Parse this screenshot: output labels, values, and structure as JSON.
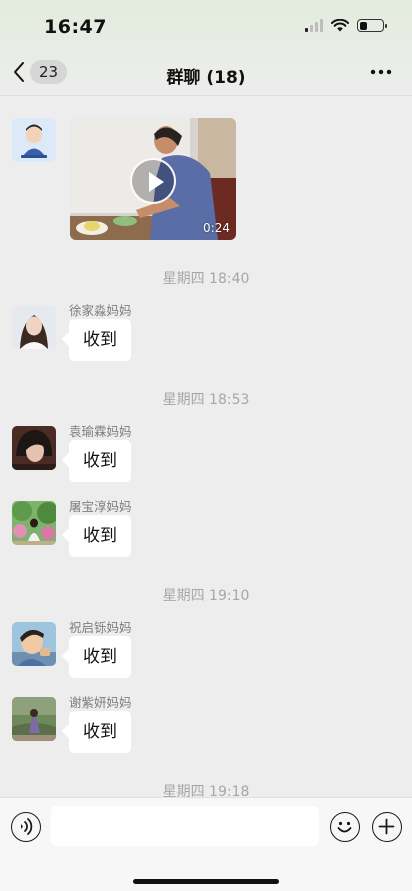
{
  "status_bar": {
    "time": "16:47",
    "battery_level": 0.35
  },
  "nav": {
    "unread_count": "23",
    "title": "群聊 (18)"
  },
  "messages": [
    {
      "type": "video",
      "duration": "0:24"
    },
    {
      "type": "time",
      "text": "星期四 18:40"
    },
    {
      "type": "text",
      "sender": "徐家淼妈妈",
      "text": "收到"
    },
    {
      "type": "time",
      "text": "星期四 18:53"
    },
    {
      "type": "text",
      "sender": "袁瑜霖妈妈",
      "text": "收到"
    },
    {
      "type": "text",
      "sender": "屠宝淳妈妈",
      "text": "收到"
    },
    {
      "type": "time",
      "text": "星期四 19:10"
    },
    {
      "type": "text",
      "sender": "祝启铄妈妈",
      "text": "收到"
    },
    {
      "type": "text",
      "sender": "谢紫妍妈妈",
      "text": "收到"
    },
    {
      "type": "time",
      "text": "星期四 19:18"
    }
  ],
  "input_bar": {
    "placeholder": ""
  },
  "icons": {
    "back": "chevron-left-icon",
    "more": "more-dots-icon",
    "voice": "voice-icon",
    "emoji": "emoji-icon",
    "add": "plus-icon"
  }
}
